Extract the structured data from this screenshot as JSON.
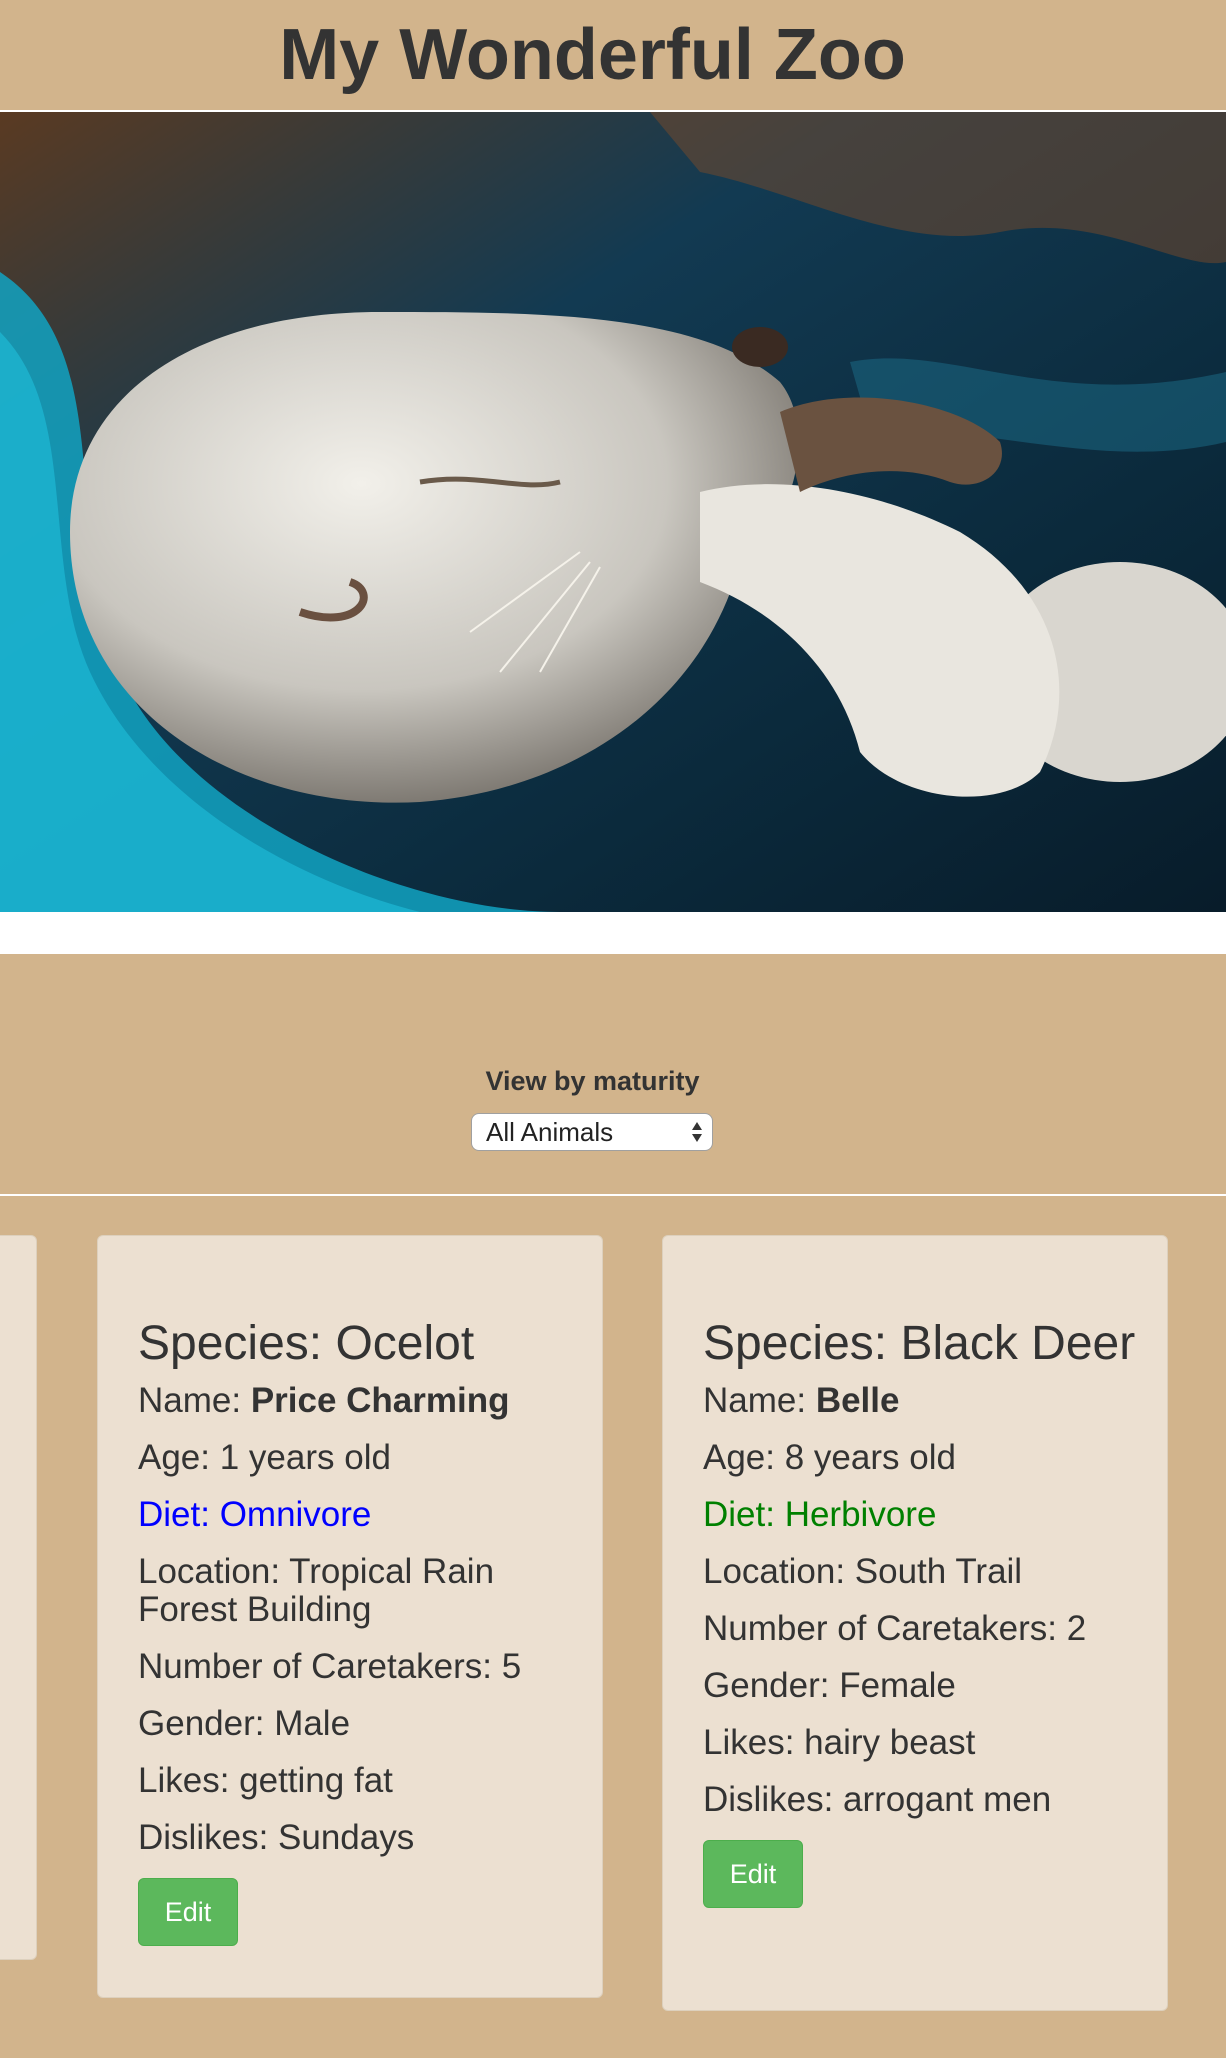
{
  "header": {
    "title": "My Wonderful Zoo"
  },
  "filter": {
    "label": "View by maturity",
    "selected": "All Animals"
  },
  "animals": [
    {
      "species": "Species: Ocelot",
      "name_label": "Name: ",
      "name": "Price Charming",
      "age": "Age: 1 years old",
      "diet": "Diet: Omnivore",
      "location": "Location: Tropical Rain Forest Building",
      "caretakers": "Number of Caretakers: 5",
      "gender": "Gender: Male",
      "likes": "Likes: getting fat",
      "dislikes": "Dislikes: Sundays",
      "edit_label": "Edit"
    },
    {
      "species": "Species: Black Deer",
      "name_label": "Name: ",
      "name": "Belle",
      "age": "Age: 8 years old",
      "diet": "Diet: Herbivore",
      "location": "Location: South Trail",
      "caretakers": "Number of Caretakers: 2",
      "gender": "Gender: Female",
      "likes": "Likes: hairy beast",
      "dislikes": "Dislikes: arrogant men",
      "edit_label": "Edit"
    }
  ],
  "colors": {
    "background": "#d2b48c",
    "card": "#ece0d1",
    "edit_button": "#5cb85c",
    "diet_omnivore": "#0000ff",
    "diet_herbivore": "#008000"
  }
}
